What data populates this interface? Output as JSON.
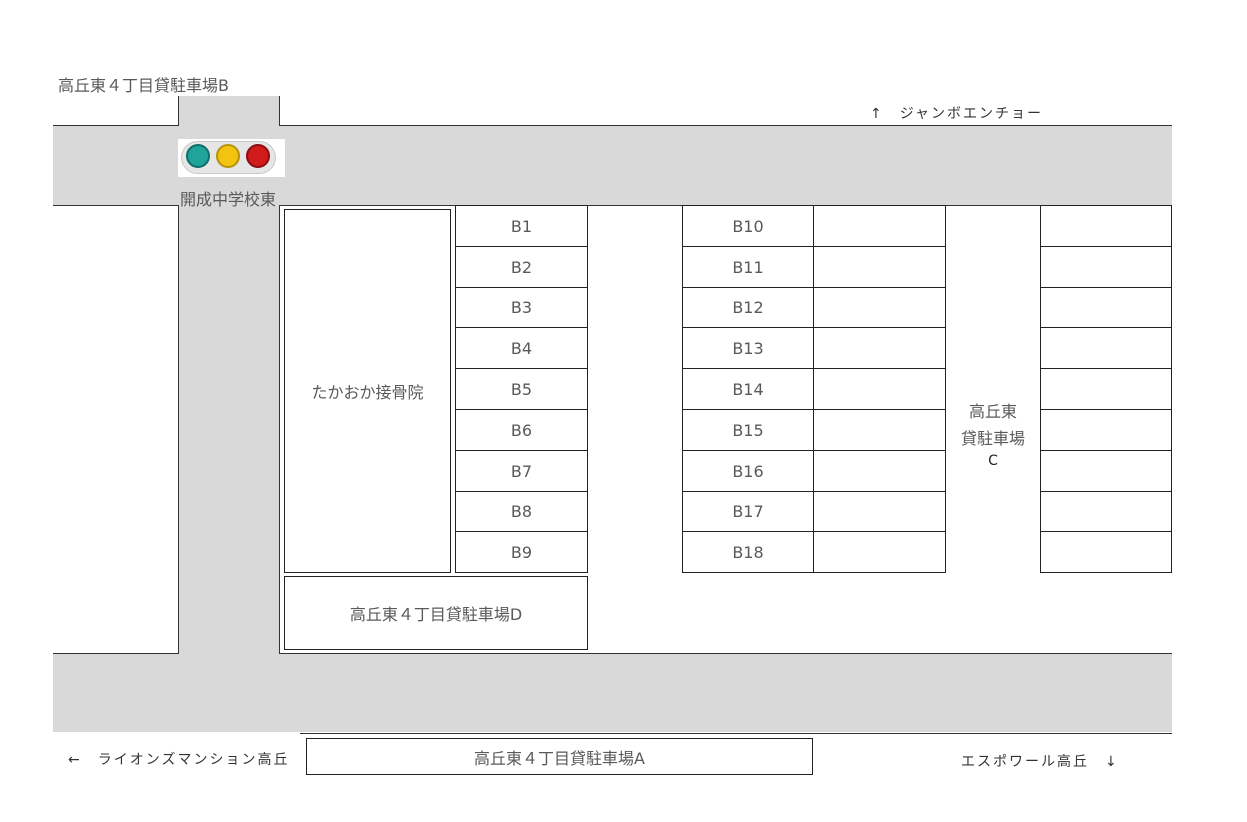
{
  "labels": {
    "parking_b_title": "高丘東４丁目貸駐車場B",
    "north_direction": "↑　ジャンボエンチョー",
    "intersection": "開成中学校東",
    "clinic": "たかおか接骨院",
    "parking_d": "高丘東４丁目貸駐車場D",
    "parking_c_line1": "高丘東",
    "parking_c_line2": "貸駐車場",
    "parking_c_line3": "C",
    "parking_a": "高丘東４丁目貸駐車場A",
    "west_direction": "←　ライオンズマンション高丘",
    "south_direction": "エスポワール高丘　↓"
  },
  "traffic_light": {
    "icon": "traffic-light-icon",
    "colors": [
      "#1fa39a",
      "#f2c40f",
      "#d11a1a"
    ]
  },
  "spaces_col1": [
    "B1",
    "B2",
    "B3",
    "B4",
    "B5",
    "B6",
    "B7",
    "B8",
    "B9"
  ],
  "spaces_col2": [
    "B10",
    "B11",
    "B12",
    "B13",
    "B14",
    "B15",
    "B16",
    "B17",
    "B18"
  ],
  "colors": {
    "road": "#d9d9d9",
    "line": "#333333",
    "text": "#595959"
  }
}
